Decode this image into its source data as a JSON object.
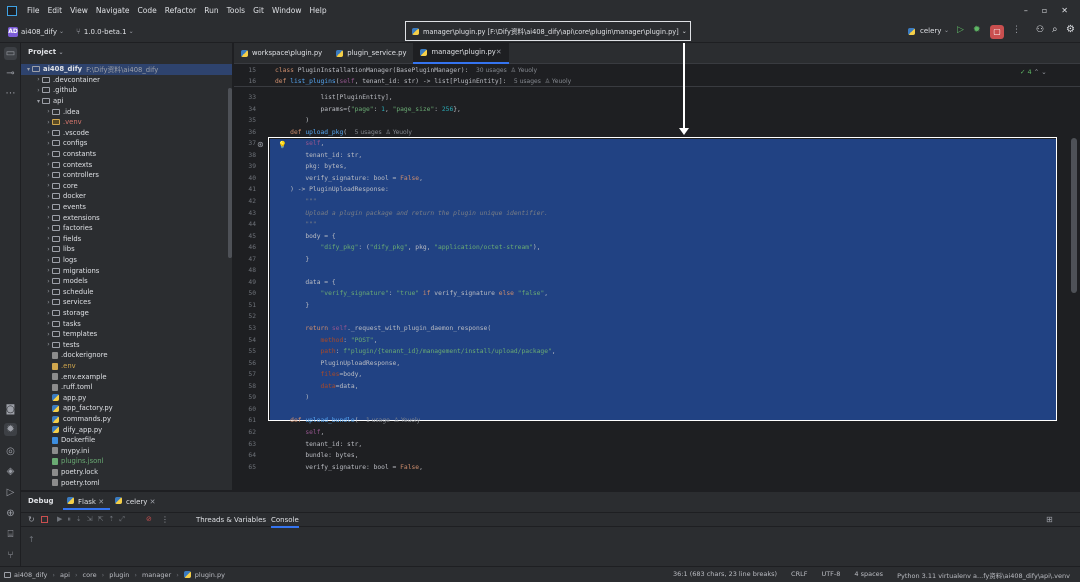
{
  "menu": [
    "File",
    "Edit",
    "View",
    "Navigate",
    "Code",
    "Refactor",
    "Run",
    "Tools",
    "Git",
    "Window",
    "Help"
  ],
  "toolbar": {
    "project_badge": "AD",
    "project_name": "ai408_dify",
    "branch": "1.0.0-beta.1",
    "path_title": "manager\\plugin.py [F:\\Dify资料\\ai408_dify\\api\\core\\plugin\\manager\\plugin.py]",
    "run_config": "celery"
  },
  "project_panel": {
    "title": "Project"
  },
  "tree": [
    {
      "label": "ai408_dify",
      "extra": "F:\\Dify资料\\ai408_dify",
      "indent": 0,
      "arrow": "▾",
      "kind": "folder",
      "color": "#dfe1e5",
      "selected": true
    },
    {
      "label": ".devcontainer",
      "indent": 1,
      "arrow": "›",
      "kind": "folder",
      "color": "#dfe1e5"
    },
    {
      "label": ".github",
      "indent": 1,
      "arrow": "›",
      "kind": "folder",
      "color": "#dfe1e5"
    },
    {
      "label": "api",
      "indent": 1,
      "arrow": "▾",
      "kind": "folder",
      "color": "#dfe1e5"
    },
    {
      "label": ".idea",
      "indent": 2,
      "arrow": "›",
      "kind": "folder",
      "color": "#dfe1e5"
    },
    {
      "label": ".venv",
      "indent": 2,
      "arrow": "›",
      "kind": "folder",
      "color": "#d5756c",
      "excluded": true
    },
    {
      "label": ".vscode",
      "indent": 2,
      "arrow": "›",
      "kind": "folder",
      "color": "#dfe1e5"
    },
    {
      "label": "configs",
      "indent": 2,
      "arrow": "›",
      "kind": "folder",
      "color": "#dfe1e5"
    },
    {
      "label": "constants",
      "indent": 2,
      "arrow": "›",
      "kind": "folder",
      "color": "#dfe1e5"
    },
    {
      "label": "contexts",
      "indent": 2,
      "arrow": "›",
      "kind": "folder",
      "color": "#dfe1e5"
    },
    {
      "label": "controllers",
      "indent": 2,
      "arrow": "›",
      "kind": "folder",
      "color": "#dfe1e5"
    },
    {
      "label": "core",
      "indent": 2,
      "arrow": "›",
      "kind": "folder",
      "color": "#dfe1e5"
    },
    {
      "label": "docker",
      "indent": 2,
      "arrow": "›",
      "kind": "folder",
      "color": "#dfe1e5"
    },
    {
      "label": "events",
      "indent": 2,
      "arrow": "›",
      "kind": "folder",
      "color": "#dfe1e5"
    },
    {
      "label": "extensions",
      "indent": 2,
      "arrow": "›",
      "kind": "folder",
      "color": "#dfe1e5"
    },
    {
      "label": "factories",
      "indent": 2,
      "arrow": "›",
      "kind": "folder",
      "color": "#dfe1e5"
    },
    {
      "label": "fields",
      "indent": 2,
      "arrow": "›",
      "kind": "folder",
      "color": "#dfe1e5"
    },
    {
      "label": "libs",
      "indent": 2,
      "arrow": "›",
      "kind": "folder",
      "color": "#dfe1e5"
    },
    {
      "label": "logs",
      "indent": 2,
      "arrow": "›",
      "kind": "folder",
      "color": "#dfe1e5"
    },
    {
      "label": "migrations",
      "indent": 2,
      "arrow": "›",
      "kind": "folder",
      "color": "#dfe1e5"
    },
    {
      "label": "models",
      "indent": 2,
      "arrow": "›",
      "kind": "folder",
      "color": "#dfe1e5"
    },
    {
      "label": "schedule",
      "indent": 2,
      "arrow": "›",
      "kind": "folder",
      "color": "#dfe1e5"
    },
    {
      "label": "services",
      "indent": 2,
      "arrow": "›",
      "kind": "folder",
      "color": "#dfe1e5"
    },
    {
      "label": "storage",
      "indent": 2,
      "arrow": "›",
      "kind": "folder",
      "color": "#dfe1e5"
    },
    {
      "label": "tasks",
      "indent": 2,
      "arrow": "›",
      "kind": "folder",
      "color": "#dfe1e5"
    },
    {
      "label": "templates",
      "indent": 2,
      "arrow": "›",
      "kind": "folder",
      "color": "#dfe1e5"
    },
    {
      "label": "tests",
      "indent": 2,
      "arrow": "›",
      "kind": "folder",
      "color": "#dfe1e5"
    },
    {
      "label": ".dockerignore",
      "indent": 2,
      "arrow": "",
      "kind": "file",
      "color": "#dfe1e5",
      "icon": "#8c8c8c"
    },
    {
      "label": ".env",
      "indent": 2,
      "arrow": "",
      "kind": "file",
      "color": "#d0a64d",
      "icon": "#d0a64d"
    },
    {
      "label": ".env.example",
      "indent": 2,
      "arrow": "",
      "kind": "file",
      "color": "#dfe1e5",
      "icon": "#8c8c8c"
    },
    {
      "label": ".ruff.toml",
      "indent": 2,
      "arrow": "",
      "kind": "file",
      "color": "#dfe1e5",
      "icon": "#8c8c8c"
    },
    {
      "label": "app.py",
      "indent": 2,
      "arrow": "",
      "kind": "file",
      "color": "#dfe1e5",
      "icon": "py"
    },
    {
      "label": "app_factory.py",
      "indent": 2,
      "arrow": "",
      "kind": "file",
      "color": "#dfe1e5",
      "icon": "py"
    },
    {
      "label": "commands.py",
      "indent": 2,
      "arrow": "",
      "kind": "file",
      "color": "#dfe1e5",
      "icon": "py"
    },
    {
      "label": "dify_app.py",
      "indent": 2,
      "arrow": "",
      "kind": "file",
      "color": "#dfe1e5",
      "icon": "py"
    },
    {
      "label": "Dockerfile",
      "indent": 2,
      "arrow": "",
      "kind": "file",
      "color": "#dfe1e5",
      "icon": "#3d8ee0"
    },
    {
      "label": "mypy.ini",
      "indent": 2,
      "arrow": "",
      "kind": "file",
      "color": "#dfe1e5",
      "icon": "#8c8c8c"
    },
    {
      "label": "plugins.jsonl",
      "indent": 2,
      "arrow": "",
      "kind": "file",
      "color": "#6aab73",
      "icon": "#6aab73"
    },
    {
      "label": "poetry.lock",
      "indent": 2,
      "arrow": "",
      "kind": "file",
      "color": "#dfe1e5",
      "icon": "#8c8c8c"
    },
    {
      "label": "poetry.toml",
      "indent": 2,
      "arrow": "",
      "kind": "file",
      "color": "#dfe1e5",
      "icon": "#8c8c8c"
    }
  ],
  "tabs": [
    {
      "label": "workspace\\plugin.py",
      "active": false
    },
    {
      "label": "plugin_service.py",
      "active": false
    },
    {
      "label": "manager\\plugin.py",
      "active": true
    }
  ],
  "sticky": {
    "line1_num": "15",
    "line1": "class PluginInstallationManager(BasePluginManager):",
    "line1_hint": "30 usages  ♙ Yeuoly",
    "line2_num": "16",
    "line2": "def list_plugins(self, tenant_id: str) -> list[PluginEntity]:",
    "line2_hint": "5 usages  ♙ Yeuoly"
  },
  "inspection": "✓ 4",
  "code_lines": [
    {
      "n": "33",
      "t": "            list[PluginEntity],"
    },
    {
      "n": "34",
      "t": "            params={\"page\": 1, \"page_size\": 256},"
    },
    {
      "n": "35",
      "t": "        )"
    },
    {
      "n": "36",
      "t": "    def upload_pkg(",
      "hint": "5 usages  ♙ Yeuoly"
    },
    {
      "n": "37",
      "t": "        self,"
    },
    {
      "n": "38",
      "t": "        tenant_id: str,"
    },
    {
      "n": "39",
      "t": "        pkg: bytes,"
    },
    {
      "n": "40",
      "t": "        verify_signature: bool = False,"
    },
    {
      "n": "41",
      "t": "    ) -> PluginUploadResponse:"
    },
    {
      "n": "42",
      "t": "        \"\"\""
    },
    {
      "n": "43",
      "t": "        Upload a plugin package and return the plugin unique identifier."
    },
    {
      "n": "44",
      "t": "        \"\"\""
    },
    {
      "n": "45",
      "t": "        body = {"
    },
    {
      "n": "46",
      "t": "            \"dify_pkg\": (\"dify_pkg\", pkg, \"application/octet-stream\"),"
    },
    {
      "n": "47",
      "t": "        }"
    },
    {
      "n": "48",
      "t": ""
    },
    {
      "n": "49",
      "t": "        data = {"
    },
    {
      "n": "50",
      "t": "            \"verify_signature\": \"true\" if verify_signature else \"false\","
    },
    {
      "n": "51",
      "t": "        }"
    },
    {
      "n": "52",
      "t": ""
    },
    {
      "n": "53",
      "t": "        return self._request_with_plugin_daemon_response("
    },
    {
      "n": "54",
      "t": "            method: \"POST\","
    },
    {
      "n": "55",
      "t": "            path: f\"plugin/{tenant_id}/management/install/upload/package\","
    },
    {
      "n": "56",
      "t": "            PluginUploadResponse,"
    },
    {
      "n": "57",
      "t": "            files=body,"
    },
    {
      "n": "58",
      "t": "            data=data,"
    },
    {
      "n": "59",
      "t": "        )"
    },
    {
      "n": "60",
      "t": ""
    },
    {
      "n": "61",
      "t": "    def upload_bundle(",
      "hint": "1 usage  ♙ Yeuoly"
    },
    {
      "n": "62",
      "t": "        self,"
    },
    {
      "n": "63",
      "t": "        tenant_id: str,"
    },
    {
      "n": "64",
      "t": "        bundle: bytes,"
    },
    {
      "n": "65",
      "t": "        verify_signature: bool = False,"
    }
  ],
  "debug": {
    "title": "Debug",
    "tab1": "Flask",
    "tab2": "celery",
    "sub1": "Threads & Variables",
    "sub2": "Console"
  },
  "status": {
    "crumbs": [
      "ai408_dify",
      "api",
      "core",
      "plugin",
      "manager",
      "plugin.py"
    ],
    "pos": "36:1 (683 chars, 23 line breaks)",
    "eol": "CRLF",
    "enc": "UTF-8",
    "indent": "4 spaces",
    "interp": "Python 3.11 virtualenv a...fy资料\\ai408_dify\\api\\.venv"
  }
}
